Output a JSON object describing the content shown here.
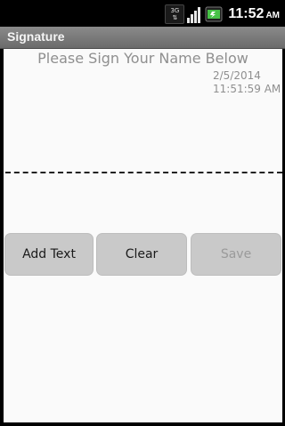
{
  "status_bar": {
    "network_label": "3G",
    "time": "11:52",
    "time_suffix": "AM",
    "icons": [
      "3g-icon",
      "signal-icon",
      "battery-icon"
    ]
  },
  "title_bar": {
    "title": "Signature"
  },
  "signature": {
    "heading": "Please Sign Your Name Below",
    "date": "2/5/2014",
    "time": "11:51:59 AM"
  },
  "buttons": {
    "add_text": "Add Text",
    "clear": "Clear",
    "save": "Save"
  },
  "colors": {
    "title_bar": "#7a7a7a",
    "canvas": "#fafafa",
    "button_bg": "#c9c9c9",
    "muted_text": "#8f8f8f"
  }
}
